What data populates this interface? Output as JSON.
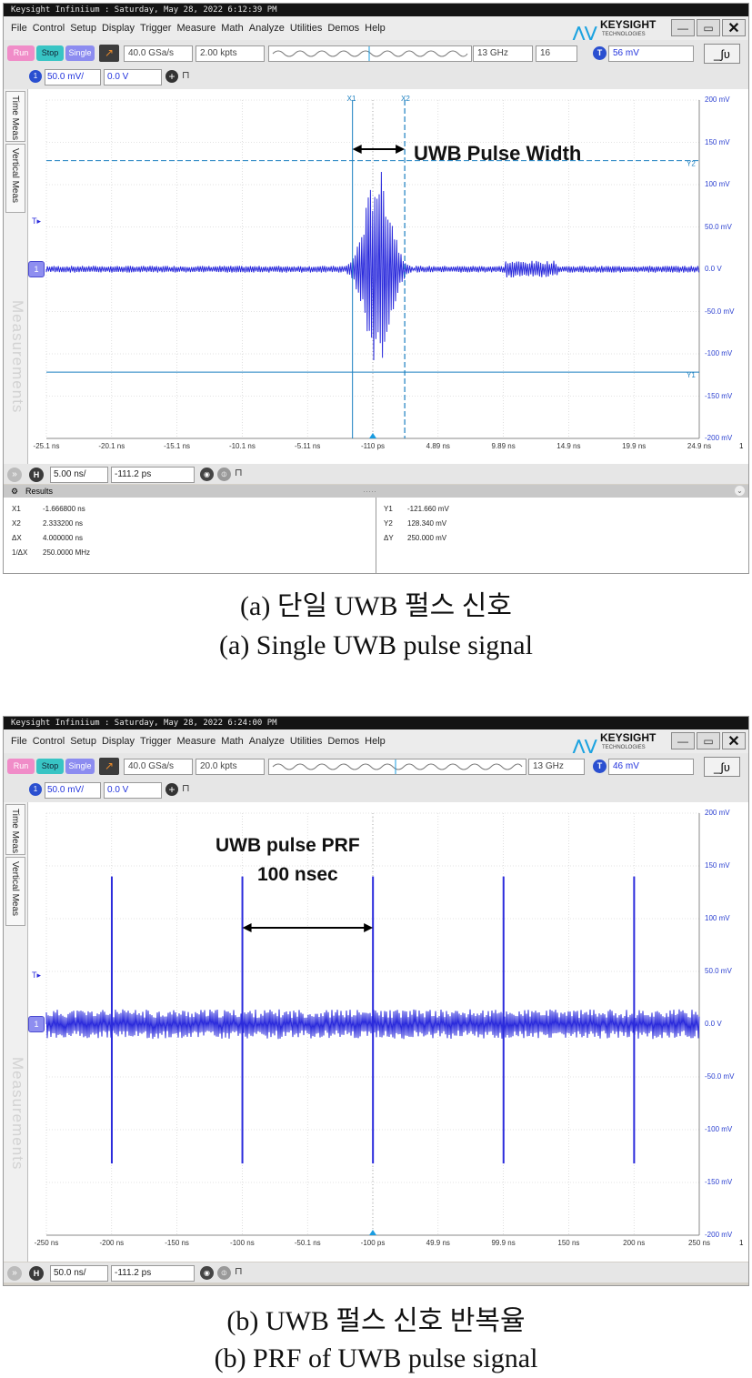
{
  "scope_a": {
    "title": "Keysight Infiniium : Saturday, May 28, 2022 6:12:39 PM",
    "menu": [
      "File",
      "Control",
      "Setup",
      "Display",
      "Trigger",
      "Measure",
      "Math",
      "Analyze",
      "Utilities",
      "Demos",
      "Help"
    ],
    "brand": "KEYSIGHT",
    "brand_sub": "TECHNOLOGIES",
    "run_label": "Run",
    "stop_label": "Stop",
    "single_label": "Single",
    "sample_rate": "40.0 GSa/s",
    "memory_depth": "2.00 kpts",
    "bandwidth": "13 GHz",
    "averages": "16",
    "trigger_channel": "T",
    "trigger_level": "56 mV",
    "channel_number": "1",
    "vertical_scale": "50.0 mV/",
    "vertical_offset": "0.0 V",
    "tab_time_meas": "Time Meas",
    "tab_vertical_meas": "Vertical Meas",
    "measurements_label": "Measurements",
    "y_ticks": [
      "200 mV",
      "150 mV",
      "100 mV",
      "50.0 mV",
      "0.0 V",
      "-50.0 mV",
      "-100 mV",
      "-150 mV",
      "-200 mV"
    ],
    "x_ticks": [
      "-25.1 ns",
      "-20.1 ns",
      "-15.1 ns",
      "-10.1 ns",
      "-5.11 ns",
      "-110 ps",
      "4.89 ns",
      "9.89 ns",
      "14.9 ns",
      "19.9 ns",
      "24.9 ns"
    ],
    "page_indicator": "1",
    "cursor_x1_label": "X1",
    "cursor_x2_label": "X2",
    "cursor_y1_label": "Y1",
    "cursor_y2_label": "Y2",
    "trigger_marker": "T",
    "annotation": "UWB Pulse Width",
    "horizontal_badge": "H",
    "horizontal_scale": "5.00 ns/",
    "horizontal_position": "-111.2 ps",
    "results_title": "Results",
    "results_left": [
      {
        "k": "X1",
        "v": "-1.666800 ns"
      },
      {
        "k": "X2",
        "v": "2.333200 ns"
      },
      {
        "k": "ΔX",
        "v": "4.000000 ns"
      },
      {
        "k": "1/ΔX",
        "v": "250.0000 MHz"
      }
    ],
    "results_right": [
      {
        "k": "Y1",
        "v": "-121.660 mV"
      },
      {
        "k": "Y2",
        "v": "128.340 mV"
      },
      {
        "k": "ΔY",
        "v": "250.000 mV"
      }
    ],
    "caption_ko": "(a) 단일 UWB 펄스 신호",
    "caption_en": "(a) Single UWB pulse signal"
  },
  "scope_b": {
    "title": "Keysight Infiniium : Saturday, May 28, 2022 6:24:00 PM",
    "menu": [
      "File",
      "Control",
      "Setup",
      "Display",
      "Trigger",
      "Measure",
      "Math",
      "Analyze",
      "Utilities",
      "Demos",
      "Help"
    ],
    "brand": "KEYSIGHT",
    "brand_sub": "TECHNOLOGIES",
    "run_label": "Run",
    "stop_label": "Stop",
    "single_label": "Single",
    "sample_rate": "40.0 GSa/s",
    "memory_depth": "20.0 kpts",
    "bandwidth": "13 GHz",
    "trigger_channel": "T",
    "trigger_level": "46 mV",
    "channel_number": "1",
    "vertical_scale": "50.0 mV/",
    "vertical_offset": "0.0 V",
    "tab_time_meas": "Time Meas",
    "tab_vertical_meas": "Vertical Meas",
    "measurements_label": "Measurements",
    "y_ticks": [
      "200 mV",
      "150 mV",
      "100 mV",
      "50.0 mV",
      "0.0 V",
      "-50.0 mV",
      "-100 mV",
      "-150 mV",
      "-200 mV"
    ],
    "x_ticks": [
      "-250 ns",
      "-200 ns",
      "-150 ns",
      "-100 ns",
      "-50.1 ns",
      "-100 ps",
      "49.9 ns",
      "99.9 ns",
      "150 ns",
      "200 ns",
      "250 ns"
    ],
    "page_indicator": "1",
    "trigger_marker": "T",
    "annotation_line1": "UWB pulse PRF",
    "annotation_line2": "100 nsec",
    "horizontal_badge": "H",
    "horizontal_scale": "50.0 ns/",
    "horizontal_position": "-111.2 ps",
    "caption_ko": "(b) UWB 펄스 신호 반복율",
    "caption_en": "(b) PRF of UWB pulse signal"
  },
  "colors": {
    "trace": "#2b2bdc",
    "cursor": "#1a7fc0",
    "grid": "#c8c8c8",
    "ytick_text": "#2a3fd0"
  }
}
